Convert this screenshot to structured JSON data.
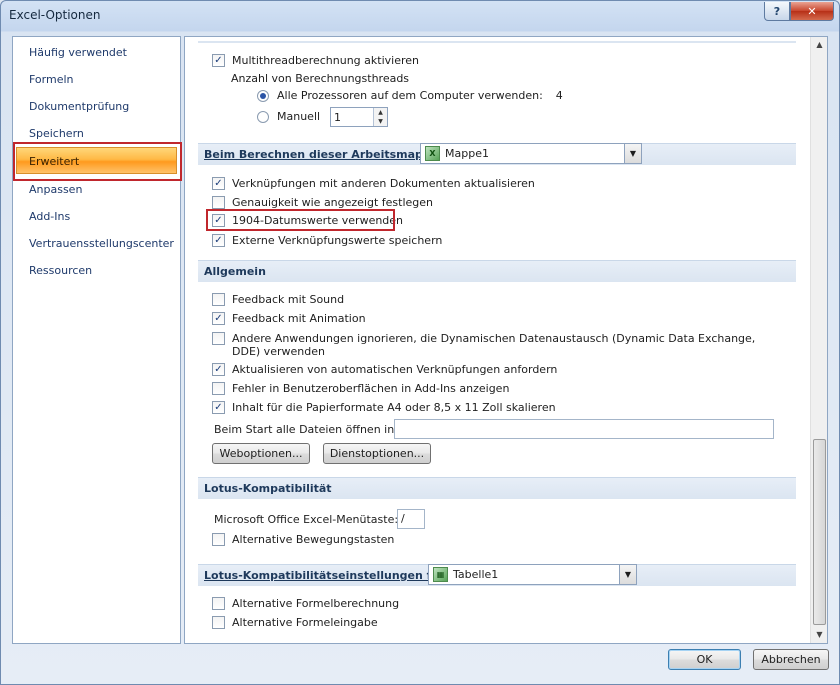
{
  "window": {
    "title": "Excel-Optionen",
    "help_glyph": "?",
    "close_glyph": "✕"
  },
  "nav": {
    "items": [
      {
        "label": "Häufig verwendet"
      },
      {
        "label": "Formeln"
      },
      {
        "label": "Dokumentprüfung"
      },
      {
        "label": "Speichern"
      },
      {
        "label": "Erweitert",
        "selected": true
      },
      {
        "label": "Anpassen"
      },
      {
        "label": "Add-Ins"
      },
      {
        "label": "Vertrauensstellungscenter"
      },
      {
        "label": "Ressourcen"
      }
    ]
  },
  "calc": {
    "multithread": {
      "label": "Multithreadberechnung aktivieren",
      "checked": true
    },
    "threads_label": "Anzahl von Berechnungsthreads",
    "all_processors": {
      "label": "Alle Prozessoren auf dem Computer verwenden:",
      "value": "4",
      "checked": true
    },
    "manual": {
      "label": "Manuell",
      "value": "1",
      "checked": false
    }
  },
  "workbook_section": {
    "title": "Beim Berechnen dieser Arbeitsmappe:",
    "workbook": "Mappe1",
    "options": [
      {
        "label": "Verknüpfungen mit anderen Dokumenten aktualisieren",
        "checked": true
      },
      {
        "label": "Genauigkeit wie angezeigt festlegen",
        "checked": false
      },
      {
        "label": "1904-Datumswerte verwenden",
        "checked": true
      },
      {
        "label": "Externe Verknüpfungswerte speichern",
        "checked": true
      }
    ]
  },
  "general": {
    "title": "Allgemein",
    "options": [
      {
        "label": "Feedback mit Sound",
        "checked": false
      },
      {
        "label": "Feedback mit Animation",
        "checked": true
      },
      {
        "label": "Andere Anwendungen ignorieren, die Dynamischen Datenaustausch (Dynamic Data Exchange, DDE) verwenden",
        "checked": false
      },
      {
        "label": "Aktualisieren von automatischen Verknüpfungen anfordern",
        "checked": true
      },
      {
        "label": "Fehler in Benutzeroberflächen in Add-Ins anzeigen",
        "checked": false
      },
      {
        "label": "Inhalt für die Papierformate A4 oder 8,5 x 11 Zoll skalieren",
        "checked": true
      }
    ],
    "startup_label": "Beim Start alle Dateien öffnen in:",
    "startup_value": "",
    "web_options_button": "Weboptionen...",
    "service_options_button": "Dienstoptionen..."
  },
  "lotus": {
    "title": "Lotus-Kompatibilität",
    "menu_key_label": "Microsoft Office Excel-Menütaste:",
    "menu_key_value": "/",
    "alt_nav": {
      "label": "Alternative Bewegungstasten",
      "checked": false
    }
  },
  "lotus_settings": {
    "title": "Lotus-Kompatibilitätseinstellungen für:",
    "sheet": "Tabelle1",
    "options": [
      {
        "label": "Alternative Formelberechnung",
        "checked": false
      },
      {
        "label": "Alternative Formeleingabe",
        "checked": false
      }
    ]
  },
  "footer": {
    "ok": "OK",
    "cancel": "Abbrechen"
  }
}
